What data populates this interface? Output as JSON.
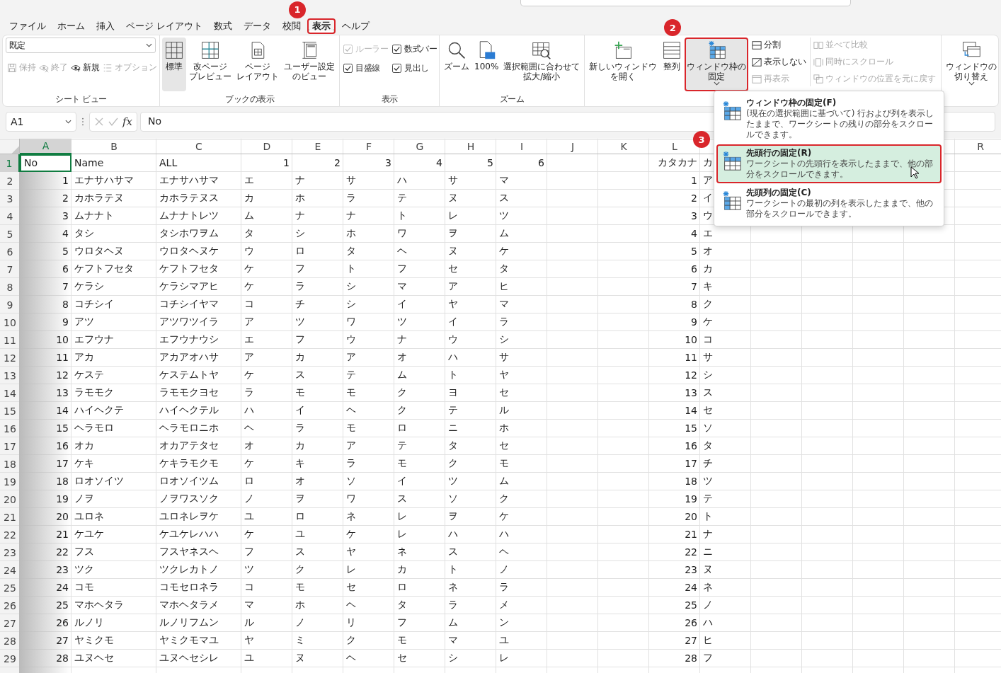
{
  "tabs": [
    {
      "label": "ファイル",
      "selected": false
    },
    {
      "label": "ホーム",
      "selected": false
    },
    {
      "label": "挿入",
      "selected": false
    },
    {
      "label": "ページ レイアウト",
      "selected": false
    },
    {
      "label": "数式",
      "selected": false
    },
    {
      "label": "データ",
      "selected": false
    },
    {
      "label": "校閲",
      "selected": false
    },
    {
      "label": "表示",
      "selected": true,
      "callout": "1"
    },
    {
      "label": "ヘルプ",
      "selected": false
    }
  ],
  "ribbon": {
    "groups": [
      {
        "kind": "sheet_view",
        "label": "シート ビュー",
        "dropdown": "既定",
        "buttons": [
          {
            "label": "保持",
            "disabled": true
          },
          {
            "label": "終了",
            "disabled": true
          },
          {
            "label": "新規",
            "disabled": false
          },
          {
            "label": "オプション",
            "disabled": true
          }
        ]
      },
      {
        "kind": "book",
        "label": "ブックの表示",
        "buttons": [
          {
            "label": [
              "標準"
            ],
            "selected": true
          },
          {
            "label": [
              "改ページ",
              "プレビュー"
            ],
            "selected": false
          },
          {
            "label": [
              "ページ",
              "レイアウト"
            ],
            "selected": false
          },
          {
            "label": [
              "ユーザー設定",
              "のビュー"
            ],
            "selected": false
          }
        ]
      },
      {
        "kind": "checks",
        "label": "表示",
        "items": [
          {
            "label": "ルーラー",
            "checked": true,
            "disabled": true
          },
          {
            "label": "数式バー",
            "checked": true,
            "disabled": false
          },
          {
            "label": "目盛線",
            "checked": true,
            "disabled": false
          },
          {
            "label": "見出し",
            "checked": true,
            "disabled": false
          }
        ]
      },
      {
        "kind": "zoom",
        "label": "ズーム",
        "buttons": [
          {
            "label": [
              "ズーム"
            ],
            "selected": false
          },
          {
            "label": [
              "100%"
            ],
            "selected": false
          },
          {
            "label": [
              "選択範囲に合わせて",
              "拡大/縮小"
            ],
            "selected": false
          }
        ]
      },
      {
        "kind": "window",
        "buttons": [
          {
            "label": [
              "新しいウィンドウ",
              "を開く"
            ],
            "selected": false,
            "dropdown": false
          },
          {
            "label": [
              "整列"
            ],
            "selected": false,
            "dropdown": false
          },
          {
            "label": [
              "ウィンドウ枠の",
              "固定"
            ],
            "selected": true,
            "dropdown": true,
            "callout": "2"
          }
        ],
        "small_columns": [
          [
            {
              "label": "分割",
              "disabled": false
            },
            {
              "label": "表示しない",
              "disabled": false
            },
            {
              "label": "再表示",
              "disabled": true
            }
          ],
          [
            {
              "label": "並べて比較",
              "disabled": true
            },
            {
              "label": "同時にスクロール",
              "disabled": true
            },
            {
              "label": "ウィンドウの位置を元に戻す",
              "disabled": true
            }
          ]
        ]
      },
      {
        "kind": "switch",
        "buttons": [
          {
            "label": [
              "ウィンドウの",
              "切り替え"
            ],
            "selected": false,
            "dropdown": true
          }
        ]
      }
    ]
  },
  "formula_bar": {
    "name_box": "A1",
    "function_button": "fx",
    "value": "No"
  },
  "freeze_menu": {
    "items": [
      {
        "title": "ウィンドウ枠の固定(F)",
        "description": "(現在の選択範囲に基づいて) 行および列を表示したままで、ワークシートの残りの部分をスクロールできます。",
        "selected": false
      },
      {
        "title": "先頭行の固定(R)",
        "description": "ワークシートの先頭行を表示したままで、他の部分をスクロールできます。",
        "selected": true,
        "callout": "3"
      },
      {
        "title": "先頭列の固定(C)",
        "description": "ワークシートの最初の列を表示したままで、他の部分をスクロールできます。",
        "selected": false
      }
    ]
  },
  "sheet": {
    "columns": [
      {
        "letter": "A",
        "kind": "number",
        "selected": true
      },
      {
        "letter": "B",
        "kind": "text",
        "selected": false
      },
      {
        "letter": "C",
        "kind": "text",
        "selected": false
      },
      {
        "letter": "D",
        "kind": "text",
        "selected": false
      },
      {
        "letter": "E",
        "kind": "text",
        "selected": false
      },
      {
        "letter": "F",
        "kind": "text",
        "selected": false
      },
      {
        "letter": "G",
        "kind": "text",
        "selected": false
      },
      {
        "letter": "H",
        "kind": "text",
        "selected": false
      },
      {
        "letter": "I",
        "kind": "text",
        "selected": false
      },
      {
        "letter": "J",
        "kind": "text",
        "selected": false
      },
      {
        "letter": "K",
        "kind": "text",
        "selected": false
      },
      {
        "letter": "L",
        "kind": "number",
        "selected": false
      },
      {
        "kind": "text"
      },
      {
        "kind": "text"
      },
      {
        "kind": "text"
      },
      {
        "kind": "text"
      },
      {
        "kind": "text"
      },
      {
        "letter": "R",
        "kind": "text",
        "selected": false
      }
    ],
    "header_row": {
      "number": "1",
      "selected": true,
      "cells": [
        {
          "text": "No",
          "kind": "text",
          "selected": true
        },
        {
          "text": "Name",
          "kind": "text",
          "selected": false
        },
        {
          "text": "ALL",
          "kind": "text",
          "selected": false
        },
        {
          "text": "1",
          "kind": "number",
          "selected": false
        },
        {
          "text": "2",
          "kind": "number",
          "selected": false
        },
        {
          "text": "3",
          "kind": "number",
          "selected": false
        },
        {
          "text": "4",
          "kind": "number",
          "selected": false
        },
        {
          "text": "5",
          "kind": "number",
          "selected": false
        },
        {
          "text": "6",
          "kind": "number",
          "selected": false
        }
      ],
      "column_l": "カタカナ",
      "column_m": "カ"
    },
    "rows": [
      {
        "number": "2",
        "selected": false,
        "cells": [
          "1",
          "エナサハサマ",
          "エナサハサマ",
          "エ",
          "ナ",
          "サ",
          "ハ",
          "サ",
          "マ"
        ],
        "column_l": "1",
        "column_m": "ア"
      },
      {
        "number": "3",
        "selected": false,
        "cells": [
          "2",
          "カホラテヌ",
          "カホラテヌス",
          "カ",
          "ホ",
          "ラ",
          "テ",
          "ヌ",
          "ス"
        ],
        "column_l": "2",
        "column_m": "イ"
      },
      {
        "number": "4",
        "selected": false,
        "cells": [
          "3",
          "ムナナト",
          "ムナナトレツ",
          "ム",
          "ナ",
          "ナ",
          "ト",
          "レ",
          "ツ"
        ],
        "column_l": "3",
        "column_m": "ウ"
      },
      {
        "number": "5",
        "selected": false,
        "cells": [
          "4",
          "タシ",
          "タシホワヲム",
          "タ",
          "シ",
          "ホ",
          "ワ",
          "ヲ",
          "ム"
        ],
        "column_l": "4",
        "column_m": "エ"
      },
      {
        "number": "6",
        "selected": false,
        "cells": [
          "5",
          "ウロタヘヌ",
          "ウロタヘヌケ",
          "ウ",
          "ロ",
          "タ",
          "ヘ",
          "ヌ",
          "ケ"
        ],
        "column_l": "5",
        "column_m": "オ"
      },
      {
        "number": "7",
        "selected": false,
        "cells": [
          "6",
          "ケフトフセタ",
          "ケフトフセタ",
          "ケ",
          "フ",
          "ト",
          "フ",
          "セ",
          "タ"
        ],
        "column_l": "6",
        "column_m": "カ"
      },
      {
        "number": "8",
        "selected": false,
        "cells": [
          "7",
          "ケラシ",
          "ケラシマアヒ",
          "ケ",
          "ラ",
          "シ",
          "マ",
          "ア",
          "ヒ"
        ],
        "column_l": "7",
        "column_m": "キ"
      },
      {
        "number": "9",
        "selected": false,
        "cells": [
          "8",
          "コチシイ",
          "コチシイヤマ",
          "コ",
          "チ",
          "シ",
          "イ",
          "ヤ",
          "マ"
        ],
        "column_l": "8",
        "column_m": "ク"
      },
      {
        "number": "10",
        "selected": false,
        "cells": [
          "9",
          "アツ",
          "アツワツイラ",
          "ア",
          "ツ",
          "ワ",
          "ツ",
          "イ",
          "ラ"
        ],
        "column_l": "9",
        "column_m": "ケ"
      },
      {
        "number": "11",
        "selected": false,
        "cells": [
          "10",
          "エフウナ",
          "エフウナウシ",
          "エ",
          "フ",
          "ウ",
          "ナ",
          "ウ",
          "シ"
        ],
        "column_l": "10",
        "column_m": "コ"
      },
      {
        "number": "12",
        "selected": false,
        "cells": [
          "11",
          "アカ",
          "アカアオハサ",
          "ア",
          "カ",
          "ア",
          "オ",
          "ハ",
          "サ"
        ],
        "column_l": "11",
        "column_m": "サ"
      },
      {
        "number": "13",
        "selected": false,
        "cells": [
          "12",
          "ケステ",
          "ケステムトヤ",
          "ケ",
          "ス",
          "テ",
          "ム",
          "ト",
          "ヤ"
        ],
        "column_l": "12",
        "column_m": "シ"
      },
      {
        "number": "14",
        "selected": false,
        "cells": [
          "13",
          "ラモモク",
          "ラモモクヨセ",
          "ラ",
          "モ",
          "モ",
          "ク",
          "ヨ",
          "セ"
        ],
        "column_l": "13",
        "column_m": "ス"
      },
      {
        "number": "15",
        "selected": false,
        "cells": [
          "14",
          "ハイヘクテ",
          "ハイヘクテル",
          "ハ",
          "イ",
          "ヘ",
          "ク",
          "テ",
          "ル"
        ],
        "column_l": "14",
        "column_m": "セ"
      },
      {
        "number": "16",
        "selected": false,
        "cells": [
          "15",
          "ヘラモロ",
          "ヘラモロニホ",
          "ヘ",
          "ラ",
          "モ",
          "ロ",
          "ニ",
          "ホ"
        ],
        "column_l": "15",
        "column_m": "ソ"
      },
      {
        "number": "17",
        "selected": false,
        "cells": [
          "16",
          "オカ",
          "オカアテタセ",
          "オ",
          "カ",
          "ア",
          "テ",
          "タ",
          "セ"
        ],
        "column_l": "16",
        "column_m": "タ"
      },
      {
        "number": "18",
        "selected": false,
        "cells": [
          "17",
          "ケキ",
          "ケキラモクモ",
          "ケ",
          "キ",
          "ラ",
          "モ",
          "ク",
          "モ"
        ],
        "column_l": "17",
        "column_m": "チ"
      },
      {
        "number": "19",
        "selected": false,
        "cells": [
          "18",
          "ロオソイツ",
          "ロオソイツム",
          "ロ",
          "オ",
          "ソ",
          "イ",
          "ツ",
          "ム"
        ],
        "column_l": "18",
        "column_m": "ツ"
      },
      {
        "number": "20",
        "selected": false,
        "cells": [
          "19",
          "ノヲ",
          "ノヲワスソク",
          "ノ",
          "ヲ",
          "ワ",
          "ス",
          "ソ",
          "ク"
        ],
        "column_l": "19",
        "column_m": "テ"
      },
      {
        "number": "21",
        "selected": false,
        "cells": [
          "20",
          "ユロネ",
          "ユロネレヲケ",
          "ユ",
          "ロ",
          "ネ",
          "レ",
          "ヲ",
          "ケ"
        ],
        "column_l": "20",
        "column_m": "ト"
      },
      {
        "number": "22",
        "selected": false,
        "cells": [
          "21",
          "ケユケ",
          "ケユケレハハ",
          "ケ",
          "ユ",
          "ケ",
          "レ",
          "ハ",
          "ハ"
        ],
        "column_l": "21",
        "column_m": "ナ"
      },
      {
        "number": "23",
        "selected": false,
        "cells": [
          "22",
          "フス",
          "フスヤネスヘ",
          "フ",
          "ス",
          "ヤ",
          "ネ",
          "ス",
          "ヘ"
        ],
        "column_l": "22",
        "column_m": "ニ"
      },
      {
        "number": "24",
        "selected": false,
        "cells": [
          "23",
          "ツク",
          "ツクレカトノ",
          "ツ",
          "ク",
          "レ",
          "カ",
          "ト",
          "ノ"
        ],
        "column_l": "23",
        "column_m": "ヌ"
      },
      {
        "number": "25",
        "selected": false,
        "cells": [
          "24",
          "コモ",
          "コモセロネラ",
          "コ",
          "モ",
          "セ",
          "ロ",
          "ネ",
          "ラ"
        ],
        "column_l": "24",
        "column_m": "ネ"
      },
      {
        "number": "26",
        "selected": false,
        "cells": [
          "25",
          "マホヘタラ",
          "マホヘタラメ",
          "マ",
          "ホ",
          "ヘ",
          "タ",
          "ラ",
          "メ"
        ],
        "column_l": "25",
        "column_m": "ノ"
      },
      {
        "number": "27",
        "selected": false,
        "cells": [
          "26",
          "ルノリ",
          "ルノリフムン",
          "ル",
          "ノ",
          "リ",
          "フ",
          "ム",
          "ン"
        ],
        "column_l": "26",
        "column_m": "ハ"
      },
      {
        "number": "28",
        "selected": false,
        "cells": [
          "27",
          "ヤミクモ",
          "ヤミクモマユ",
          "ヤ",
          "ミ",
          "ク",
          "モ",
          "マ",
          "ユ"
        ],
        "column_l": "27",
        "column_m": "ヒ"
      },
      {
        "number": "29",
        "selected": false,
        "cells": [
          "28",
          "ユヌヘセ",
          "ユヌヘセシレ",
          "ユ",
          "ヌ",
          "ヘ",
          "セ",
          "シ",
          "レ"
        ],
        "column_l": "28",
        "column_m": "フ"
      }
    ]
  }
}
